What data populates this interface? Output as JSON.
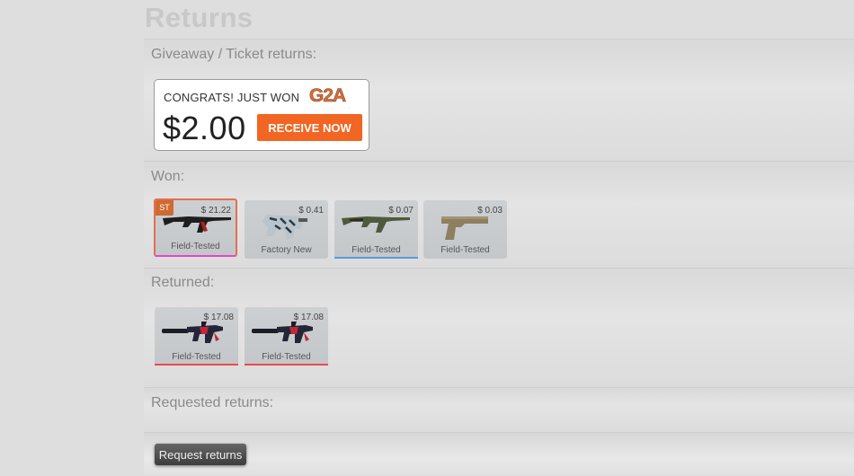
{
  "page": {
    "title": "Returns"
  },
  "sections": {
    "giveaway": {
      "label": "Giveaway / Ticket returns:"
    },
    "won": {
      "label": "Won:"
    },
    "returned": {
      "label": "Returned:"
    },
    "requested": {
      "label": "Requested returns:"
    }
  },
  "g2a": {
    "congrats": "CONGRATS! JUST WON",
    "logo": "G2A",
    "amount": "$2.00",
    "button": "RECEIVE NOW",
    "button_color": "#f26522"
  },
  "won_items": [
    {
      "price": "$ 21.22",
      "wear": "Field-Tested",
      "badge": "ST",
      "weapon": "ak47-dark",
      "rarity_color": "#e04ac4",
      "selected": true
    },
    {
      "price": "$ 0.41",
      "wear": "Factory New",
      "weapon": "p90-snow",
      "rarity_color": "#c4c7ca"
    },
    {
      "price": "$ 0.07",
      "wear": "Field-Tested",
      "weapon": "ak47-olive",
      "rarity_color": "#5e98d9"
    },
    {
      "price": "$ 0.03",
      "wear": "Field-Tested",
      "weapon": "p2000-tan",
      "rarity_color": "#c4c7ca"
    }
  ],
  "returned_items": [
    {
      "price": "$ 17.08",
      "wear": "Field-Tested",
      "weapon": "m4a1s-red",
      "rarity_color": "#eb4b4b"
    },
    {
      "price": "$ 17.08",
      "wear": "Field-Tested",
      "weapon": "m4a1s-red",
      "rarity_color": "#eb4b4b"
    }
  ],
  "actions": {
    "request_returns": "Request returns"
  }
}
